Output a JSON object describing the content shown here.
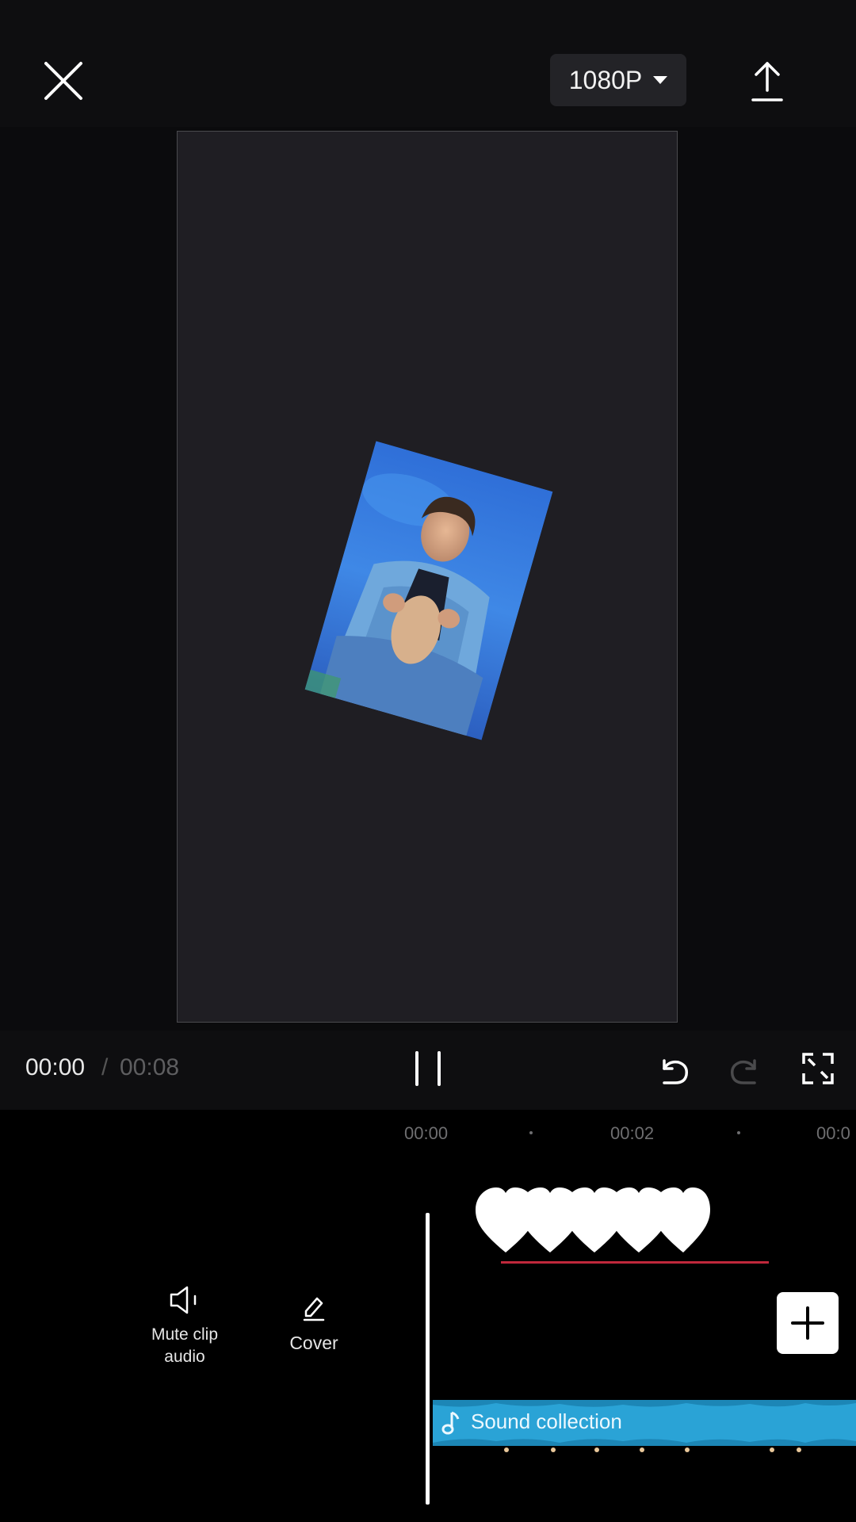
{
  "header": {
    "resolution_label": "1080P"
  },
  "player": {
    "current_time": "00:00",
    "separator": "/",
    "total_time": "00:08"
  },
  "timeline": {
    "ruler_labels": [
      "00:00",
      "00:02",
      "00:0"
    ]
  },
  "tools": {
    "mute_label_line1": "Mute clip",
    "mute_label_line2": "audio",
    "cover_label": "Cover"
  },
  "audio_track": {
    "label": "Sound collection"
  },
  "colors": {
    "background": "#000000",
    "preview_canvas": "#1f1e23",
    "audio_track": "#2aa3d6",
    "marker_line": "#c0283b"
  },
  "icons": [
    "close-icon",
    "caret-down-icon",
    "export-icon",
    "pause-icon",
    "undo-icon",
    "redo-icon",
    "fullscreen-icon",
    "speaker-icon",
    "pencil-icon",
    "plus-icon",
    "music-note-icon",
    "heart-icon"
  ]
}
